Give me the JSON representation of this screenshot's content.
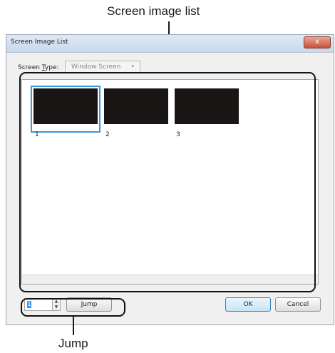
{
  "callouts": {
    "top": "Screen image list",
    "bottom": "Jump"
  },
  "dialog": {
    "title": "Screen Image List",
    "close_symbol": "x"
  },
  "screen_type": {
    "label_prefix": "Screen ",
    "label_accel": "T",
    "label_suffix": "ype:",
    "value": "Window Screen",
    "arrow": "▾"
  },
  "thumbnails": [
    {
      "number": "1",
      "selected": true
    },
    {
      "number": "2",
      "selected": false
    },
    {
      "number": "3",
      "selected": false
    }
  ],
  "jump": {
    "value": "1",
    "up_arrow": "▲",
    "down_arrow": "▼",
    "button_accel": "J",
    "button_rest": "ump"
  },
  "buttons": {
    "ok": "OK",
    "cancel": "Cancel"
  },
  "colors": {
    "selection": "#3399e0",
    "thumbnail": "#1a1615"
  }
}
